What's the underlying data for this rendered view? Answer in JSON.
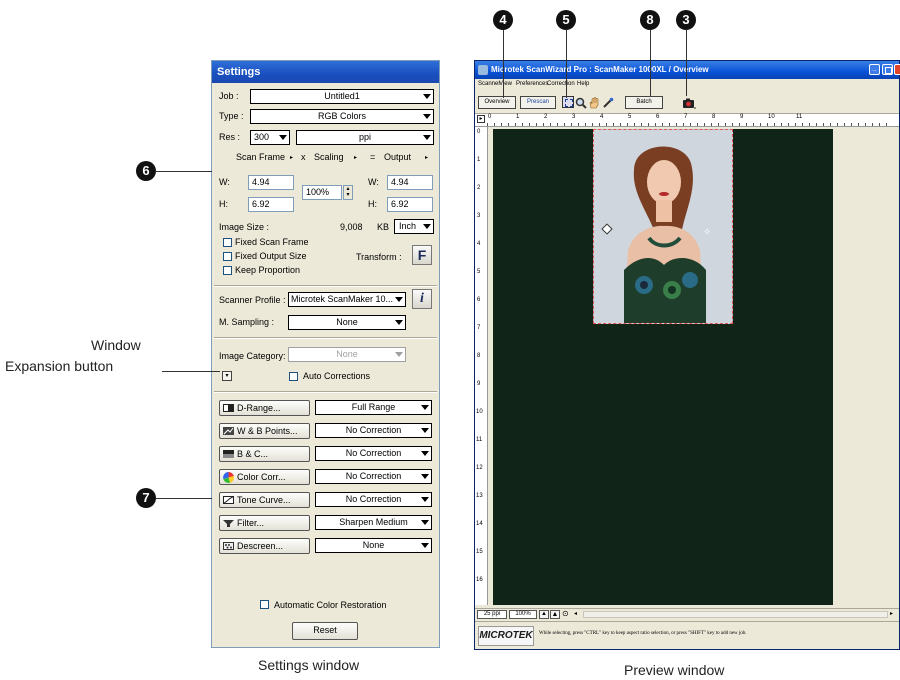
{
  "settings": {
    "title": "Settings",
    "job_label": "Job :",
    "job_value": "Untitled1",
    "type_label": "Type :",
    "type_value": "RGB Colors",
    "res_label": "Res :",
    "res_value": "300",
    "res_unit": "ppi",
    "scan_frame_label": "Scan Frame",
    "x_symbol": "x",
    "scaling_label": "Scaling",
    "eq_symbol": "=",
    "output_label": "Output",
    "w_label": "W:",
    "h_label": "H:",
    "scan_w": "4.94",
    "scan_h": "6.92",
    "scaling_value": "100%",
    "out_w": "4.94",
    "out_h": "6.92",
    "image_size_label": "Image Size :",
    "image_size_value": "9,008",
    "image_size_unit": "KB",
    "units_value": "Inch",
    "fixed_scan_frame": "Fixed Scan Frame",
    "fixed_output_size": "Fixed Output Size",
    "keep_proportion": "Keep Proportion",
    "transform_label": "Transform :",
    "transform_icon_text": "F",
    "scanner_profile_label": "Scanner Profile :",
    "scanner_profile_value": "Microtek ScanMaker 10...",
    "info_icon_text": "i",
    "m_sampling_label": "M. Sampling :",
    "m_sampling_value": "None",
    "image_category_label": "Image Category:",
    "image_category_value": "None",
    "auto_corrections": "Auto Corrections",
    "tools": [
      {
        "label": "D-Range...",
        "value": "Full Range"
      },
      {
        "label": "W & B Points...",
        "value": "No Correction"
      },
      {
        "label": "B & C...",
        "value": "No Correction"
      },
      {
        "label": "Color Corr...",
        "value": "No Correction"
      },
      {
        "label": "Tone Curve...",
        "value": "No Correction"
      },
      {
        "label": "Filter...",
        "value": "Sharpen Medium"
      },
      {
        "label": "Descreen...",
        "value": "None"
      }
    ],
    "auto_color_restoration": "Automatic Color Restoration",
    "reset_label": "Reset"
  },
  "preview": {
    "title": "Microtek ScanWizard Pro : ScanMaker 1000XL / Overview",
    "menus": [
      "Scanner",
      "View",
      "Preferences",
      "Correction",
      "Help"
    ],
    "overview_label": "Overview",
    "prescan_label": "Prescan",
    "batch_label": "Batch",
    "ruler_top": [
      "0",
      "1",
      "2",
      "3",
      "4",
      "5",
      "6",
      "7",
      "8",
      "9",
      "10",
      "11"
    ],
    "ruler_left": [
      "0",
      "1",
      "2",
      "3",
      "4",
      "5",
      "6",
      "7",
      "8",
      "9",
      "10",
      "11",
      "12",
      "13",
      "14",
      "15",
      "16"
    ],
    "zoom_res": "25 ppi",
    "zoom_pct": "100%",
    "logo": "MICROTEK",
    "status_text": "While selecting, press \"CTRL\" key to keep aspect ratio selection, or press \"SHIFT\" key to add new job."
  },
  "annotations": {
    "callout_4": "4",
    "callout_5": "5",
    "callout_8": "8",
    "callout_3": "3",
    "callout_6": "6",
    "callout_7": "7",
    "window_expansion_line1": "Window",
    "window_expansion_line2": "Expansion button",
    "settings_caption": "Settings window",
    "preview_caption": "Preview window"
  },
  "colors": {
    "preview_bg": "#102418",
    "accent_title": "#1a4fc0"
  }
}
